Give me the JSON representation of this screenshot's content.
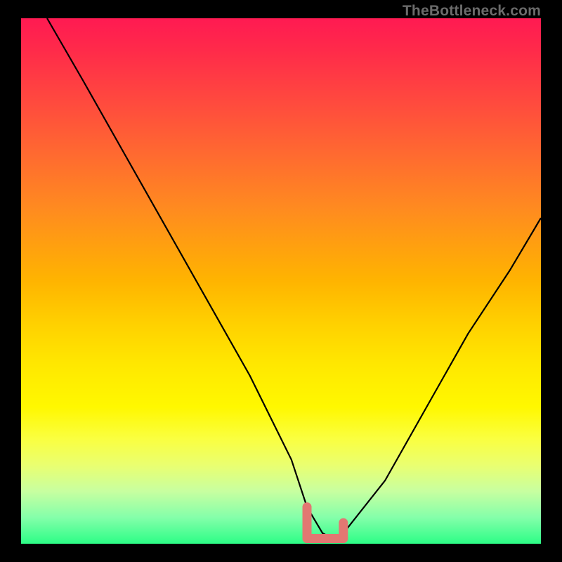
{
  "watermark": "TheBottleneck.com",
  "chart_data": {
    "type": "line",
    "title": "",
    "xlabel": "",
    "ylabel": "",
    "xlim": [
      0,
      100
    ],
    "ylim": [
      0,
      100
    ],
    "grid": false,
    "legend": false,
    "series": [
      {
        "name": "bottleneck-curve",
        "color": "#000000",
        "x": [
          5,
          12,
          20,
          28,
          36,
          44,
          52,
          55,
          58,
          60,
          62,
          70,
          78,
          86,
          94,
          100
        ],
        "values": [
          100,
          88,
          74,
          60,
          46,
          32,
          16,
          7,
          2,
          1,
          2,
          12,
          26,
          40,
          52,
          62
        ]
      },
      {
        "name": "highlight-left-vertical",
        "color": "#e27772",
        "x": [
          55,
          55
        ],
        "values": [
          7,
          1
        ]
      },
      {
        "name": "highlight-bottom",
        "color": "#e27772",
        "x": [
          55,
          62
        ],
        "values": [
          1,
          1
        ]
      },
      {
        "name": "highlight-right-vertical",
        "color": "#e27772",
        "x": [
          62,
          62
        ],
        "values": [
          4,
          1
        ]
      }
    ],
    "gradient_stops": [
      {
        "pos": 0.0,
        "color": "#ff1a52"
      },
      {
        "pos": 0.5,
        "color": "#ffb400"
      },
      {
        "pos": 0.74,
        "color": "#fff800"
      },
      {
        "pos": 1.0,
        "color": "#2cfd86"
      }
    ]
  }
}
